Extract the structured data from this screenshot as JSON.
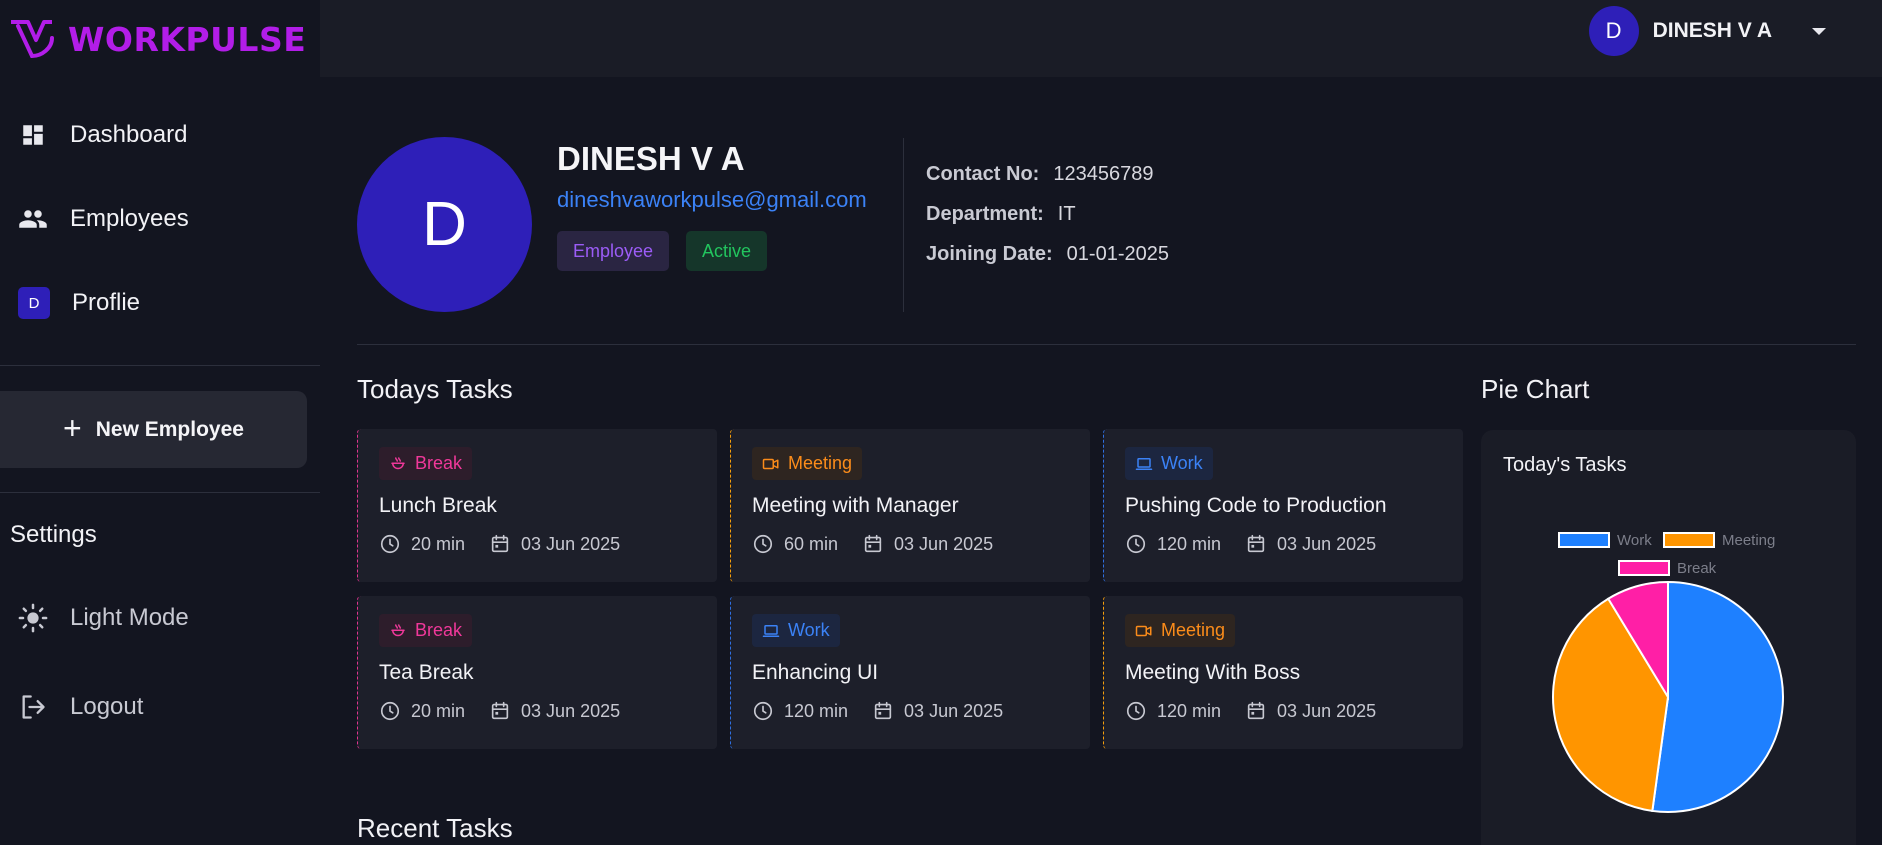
{
  "app": {
    "name": "WORKPULSE"
  },
  "sidebar": {
    "nav": [
      {
        "label": "Dashboard",
        "icon": "dashboard-icon"
      },
      {
        "label": "Employees",
        "icon": "people-icon"
      },
      {
        "label": "Proflie",
        "icon": "avatar",
        "avatar_letter": "D"
      }
    ],
    "new_employee_label": "New Employee",
    "settings_title": "Settings",
    "light_mode_label": "Light Mode",
    "logout_label": "Logout"
  },
  "topbar": {
    "avatar_letter": "D",
    "user_name": "DINESH V A"
  },
  "profile": {
    "avatar_letter": "D",
    "name": "DINESH V A",
    "email": "dineshvaworkpulse@gmail.com",
    "role_badge": "Employee",
    "status_badge": "Active",
    "contact_label": "Contact No:",
    "contact_value": "123456789",
    "department_label": "Department:",
    "department_value": "IT",
    "joining_label": "Joining Date:",
    "joining_value": "01-01-2025"
  },
  "todays_tasks": {
    "title": "Todays Tasks",
    "items": [
      {
        "type": "break",
        "tag": "Break",
        "title": "Lunch Break",
        "duration": "20 min",
        "date": "03 Jun 2025"
      },
      {
        "type": "meeting",
        "tag": "Meeting",
        "title": "Meeting with Manager",
        "duration": "60 min",
        "date": "03 Jun 2025"
      },
      {
        "type": "work",
        "tag": "Work",
        "title": "Pushing Code to Production",
        "duration": "120 min",
        "date": "03 Jun 2025"
      },
      {
        "type": "break",
        "tag": "Break",
        "title": "Tea Break",
        "duration": "20 min",
        "date": "03 Jun 2025"
      },
      {
        "type": "work",
        "tag": "Work",
        "title": "Enhancing UI",
        "duration": "120 min",
        "date": "03 Jun 2025"
      },
      {
        "type": "meeting",
        "tag": "Meeting",
        "title": "Meeting With Boss",
        "duration": "120 min",
        "date": "03 Jun 2025"
      }
    ]
  },
  "recent_tasks": {
    "title": "Recent Tasks"
  },
  "pie_section": {
    "title": "Pie Chart"
  },
  "chart_data": {
    "type": "pie",
    "title": "Today's Tasks",
    "categories": [
      "Work",
      "Meeting",
      "Break"
    ],
    "values": [
      240,
      180,
      40
    ],
    "colors": [
      "#1e80ff",
      "#ff9500",
      "#ff1fa6"
    ],
    "legend_position": "top"
  },
  "colors": {
    "brand": "#b21de8",
    "accent": "#2e1fb8",
    "break": "#f0389a",
    "meeting": "#fb8c1a",
    "work": "#3b82f6",
    "active": "#22c55e"
  }
}
